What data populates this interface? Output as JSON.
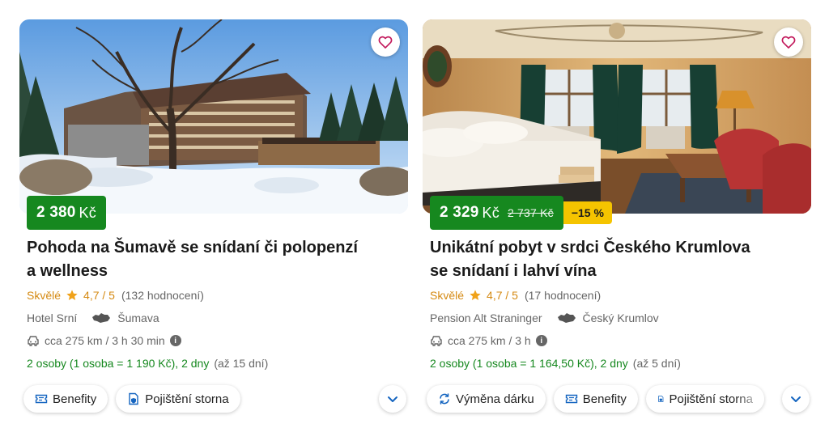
{
  "offers": [
    {
      "price": "2 380",
      "currency": "Kč",
      "title_line1": "Pohoda na Šumavě se snídaní či polopenzí",
      "title_line2": "a wellness",
      "rating_word": "Skvělé",
      "rating_score": "4,7 / 5",
      "rating_count": "(132 hodnocení)",
      "hotel": "Hotel Srní",
      "region": "Šumava",
      "travel": "cca 275 km / 3 h 30 min",
      "persons": "2 osoby (1 osoba = 1 190 Kč), 2 dny",
      "persons_extra": "(až 15 dní)",
      "chips": [
        "Benefity",
        "Pojištění storna"
      ]
    },
    {
      "price": "2 329",
      "currency": "Kč",
      "old_price": "2 737 Kč",
      "discount": "−15 %",
      "title_line1": "Unikátní pobyt v srdci Českého Krumlova",
      "title_line2": "se snídaní i lahví vína",
      "rating_word": "Skvělé",
      "rating_score": "4,7 / 5",
      "rating_count": "(17 hodnocení)",
      "hotel": "Pension Alt Straninger",
      "region": "Český Krumlov",
      "travel": "cca 275 km / 3 h",
      "persons": "2 osoby (1 osoba = 1 164,50 Kč), 2 dny",
      "persons_extra": "(až 5 dní)",
      "chips": [
        "Výměna dárku",
        "Benefity",
        "Pojištění storna"
      ]
    }
  ],
  "icons": {
    "favorite": "heart-outline-icon",
    "rating": "star-icon",
    "region": "czech-map-icon",
    "travel": "car-icon",
    "info": "info-icon",
    "benefity": "ticket-icon",
    "insurance": "shield-document-icon",
    "exchange": "exchange-icon",
    "expand": "chevron-down-icon"
  },
  "colors": {
    "price_bg": "#16881f",
    "discount_bg": "#f5c400",
    "rating": "#d58a13",
    "persons": "#16881f",
    "chevron": "#1565c0",
    "heart": "#c2185b"
  }
}
